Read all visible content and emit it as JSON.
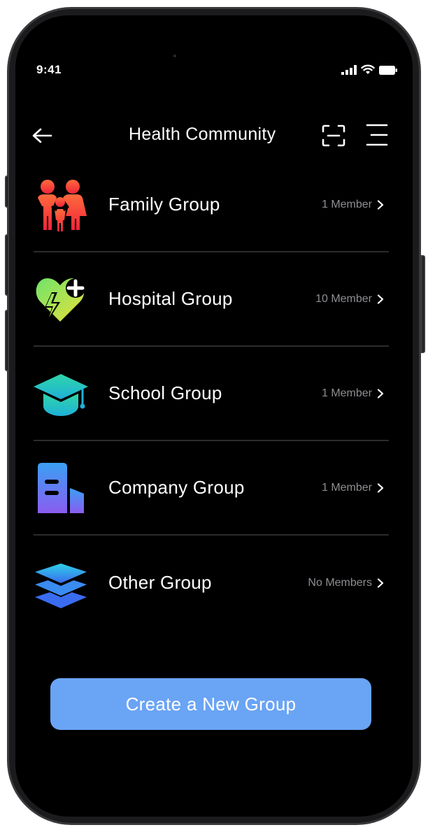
{
  "status_bar": {
    "time": "9:41",
    "icons": [
      "signal-icon",
      "wifi-icon",
      "battery-icon"
    ]
  },
  "header": {
    "title": "Health Community",
    "back_icon": "arrow-left-icon",
    "scan_icon": "scan-icon",
    "menu_icon": "menu-icon"
  },
  "groups": [
    {
      "name": "Family Group",
      "count": "1 Member",
      "icon": "family-icon"
    },
    {
      "name": "Hospital Group",
      "count": "10 Member",
      "icon": "heart-health-icon"
    },
    {
      "name": "School Group",
      "count": "1 Member",
      "icon": "graduation-cap-icon"
    },
    {
      "name": "Company Group",
      "count": "1 Member",
      "icon": "building-icon"
    },
    {
      "name": "Other Group",
      "count": "No Members",
      "icon": "layers-icon"
    }
  ],
  "cta": {
    "label": "Create a New Group"
  },
  "colors": {
    "background": "#000000",
    "text": "#ffffff",
    "muted_text": "#8e8e93",
    "divider": "#2c2c2e",
    "button": "#6aa4f4"
  }
}
